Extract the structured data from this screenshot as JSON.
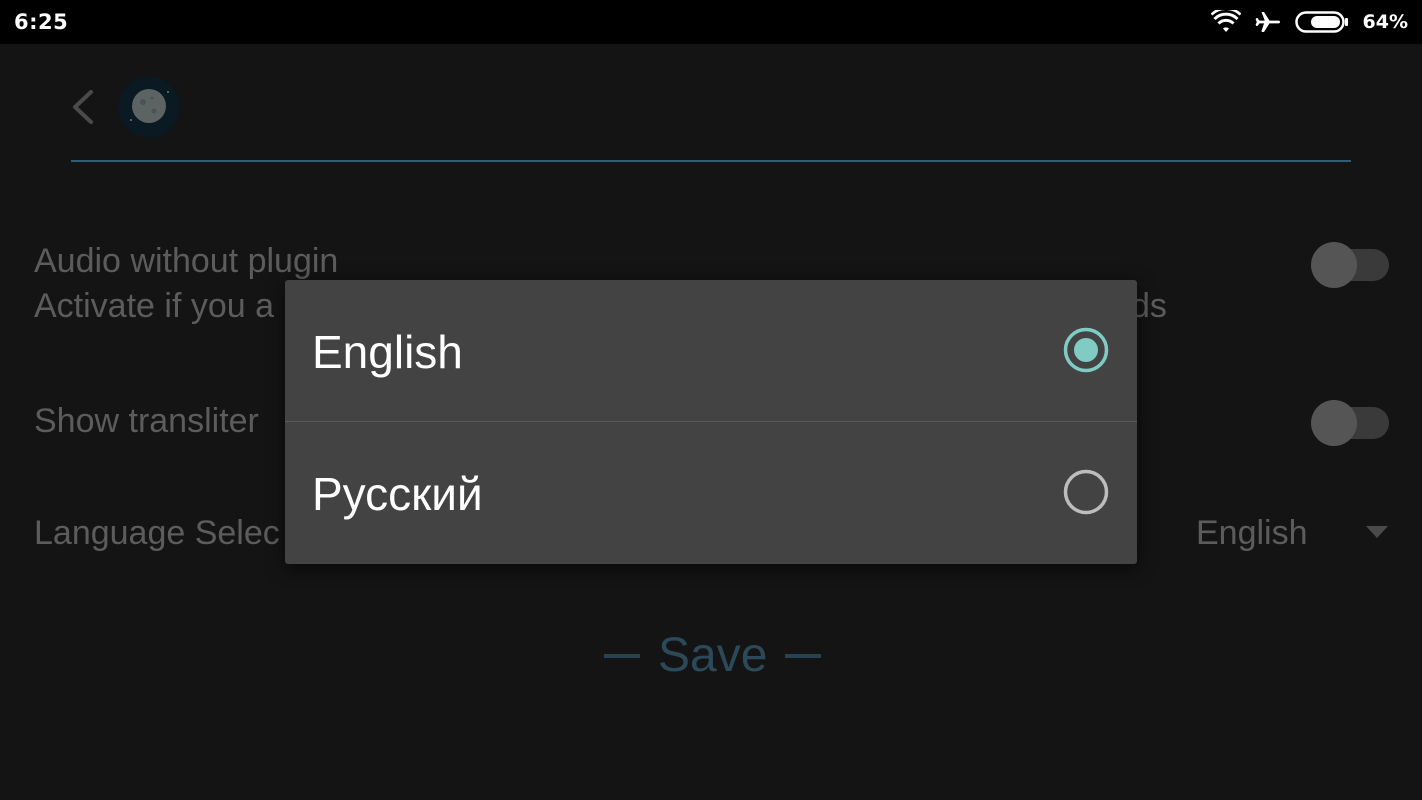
{
  "status_bar": {
    "time": "6:25",
    "battery_percent": "64%",
    "icons": [
      "wifi-icon",
      "airplane-mode-icon",
      "battery-icon"
    ]
  },
  "header": {
    "back_icon": "chevron-left-icon",
    "logo": "moon-logo"
  },
  "settings": {
    "audio_title": "Audio without plugin",
    "audio_subtitle": "Activate if you a",
    "audio_subtitle_tail": "ds",
    "audio_enabled": false,
    "translit_title": "Show transliter",
    "translit_enabled": false,
    "language_title": "Language Selec",
    "language_value": "English"
  },
  "save": {
    "label": "Save"
  },
  "dialog": {
    "options": [
      {
        "label": "English",
        "selected": true
      },
      {
        "label": "Русский",
        "selected": false
      }
    ]
  },
  "colors": {
    "accent": "#80cbc4",
    "dialog_bg": "#434343",
    "header_line": "#2f5f72"
  }
}
